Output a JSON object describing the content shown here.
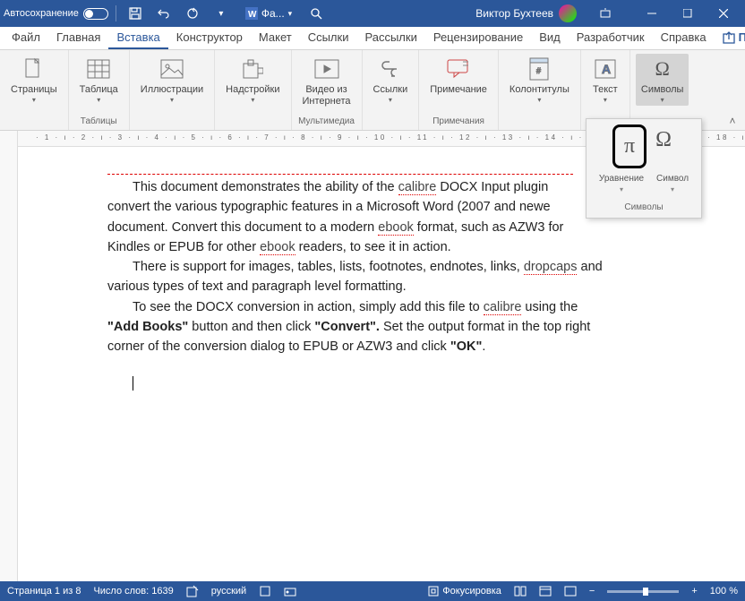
{
  "titlebar": {
    "autosave": "Автосохранение",
    "doc": "Фа...",
    "user": "Виктор Бухтеев"
  },
  "tabs": [
    "Файл",
    "Главная",
    "Вставка",
    "Конструктор",
    "Макет",
    "Ссылки",
    "Рассылки",
    "Рецензирование",
    "Вид",
    "Разработчик",
    "Справка"
  ],
  "active_tab": 2,
  "share": "Поделиться",
  "ribbon": {
    "pages": {
      "label": "Страницы"
    },
    "tables": {
      "btn": "Таблица",
      "group": "Таблицы"
    },
    "illus": {
      "btn": "Иллюстрации"
    },
    "addins": {
      "btn": "Надстройки"
    },
    "media": {
      "btn": "Видео из\nИнтернета",
      "group": "Мультимедиа"
    },
    "links": {
      "btn": "Ссылки"
    },
    "comment": {
      "btn": "Примечание",
      "group": "Примечания"
    },
    "headfoot": {
      "btn": "Колонтитулы"
    },
    "text": {
      "btn": "Текст"
    },
    "symbols": {
      "btn": "Символы"
    }
  },
  "dropdown": {
    "eq": "Уравнение",
    "sym": "Символ",
    "group": "Символы"
  },
  "document": {
    "p1a": "This document demonstrates the ability of the ",
    "p1b": " DOCX Input plugin",
    "p2": "convert the various typographic features in a Microsoft Word (2007 and newe",
    "p3a": "document. Convert this document to a modern ",
    "p3b": " format, such as AZW3 for",
    "p4a": "Kindles or EPUB for other ",
    "p4b": " readers, to see it in action.",
    "p5a": "There is support for images, tables, lists, footnotes, endnotes, links, ",
    "p5b": " and",
    "p6": "various types of text and paragraph level formatting.",
    "p7a": "To see the DOCX conversion in action, simply add this file to ",
    "p7b": " using the",
    "p8a": "\"Add Books\"",
    "p8b": " button and then click ",
    "p8c": "\"Convert\".",
    "p8d": "  Set the output format in the top right",
    "p9a": "corner of the conversion dialog to EPUB or AZW3 and click ",
    "p9b": "\"OK\"",
    "p9c": ".",
    "sq_calibre": "calibre",
    "sq_ebook": "ebook",
    "sq_dropcaps": "dropcaps"
  },
  "status": {
    "page": "Страница 1 из 8",
    "words": "Число слов: 1639",
    "lang": "русский",
    "focus": "Фокусировка",
    "zoom": "100 %"
  }
}
